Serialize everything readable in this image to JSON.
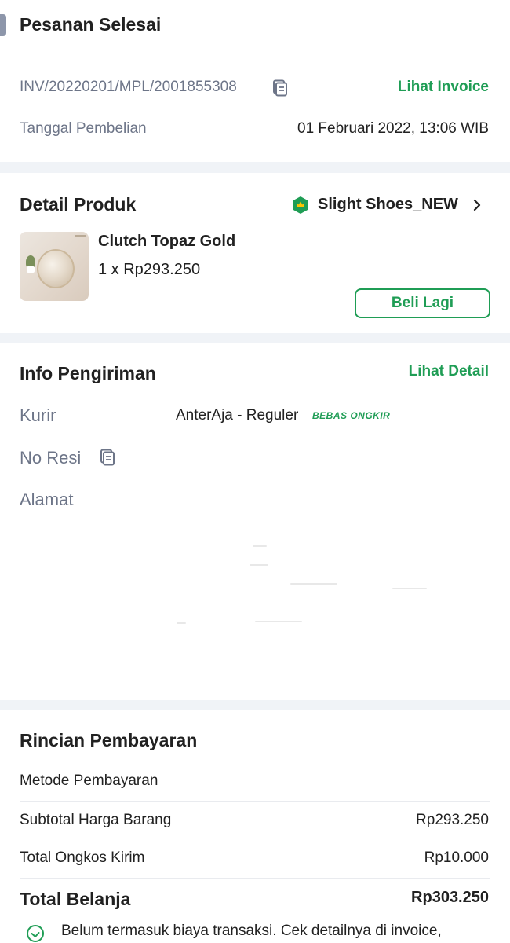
{
  "order": {
    "status_title": "Pesanan Selesai",
    "invoice_number": "INV/20220201/MPL/2001855308",
    "invoice_link": "Lihat Invoice",
    "purchase_date_label": "Tanggal Pembelian",
    "purchase_date_value": "01 Februari 2022, 13:06 WIB"
  },
  "product_detail": {
    "title": "Detail Produk",
    "shop_name": "Slight Shoes_NEW",
    "product_name": "Clutch Topaz Gold",
    "quantity_price": "1 x Rp293.250",
    "buy_again_label": "Beli Lagi"
  },
  "shipping": {
    "title": "Info Pengiriman",
    "detail_link": "Lihat Detail",
    "courier_label": "Kurir",
    "courier_value": "AnterAja - Reguler",
    "free_shipping_badge": "BEBAS ONGKIR",
    "receipt_label": "No Resi",
    "address_label": "Alamat"
  },
  "payment": {
    "title": "Rincian Pembayaran",
    "method_label": "Metode Pembayaran",
    "subtotal_label": "Subtotal Harga Barang",
    "subtotal_value": "Rp293.250",
    "shipping_cost_label": "Total Ongkos Kirim",
    "shipping_cost_value": "Rp10.000",
    "total_label": "Total Belanja",
    "total_value": "Rp303.250",
    "note": "Belum termasuk biaya transaksi. Cek detailnya di invoice,"
  },
  "colors": {
    "accent_green": "#1f9d55",
    "shop_badge_green": "#1f9d55",
    "shop_badge_crown": "#ffc400",
    "divider": "#f0f3f7"
  },
  "icons": {
    "copy": "copy-icon",
    "shop_badge": "power-merchant-badge-icon",
    "chevron": "chevron-right-icon",
    "info": "check-circle-icon"
  }
}
